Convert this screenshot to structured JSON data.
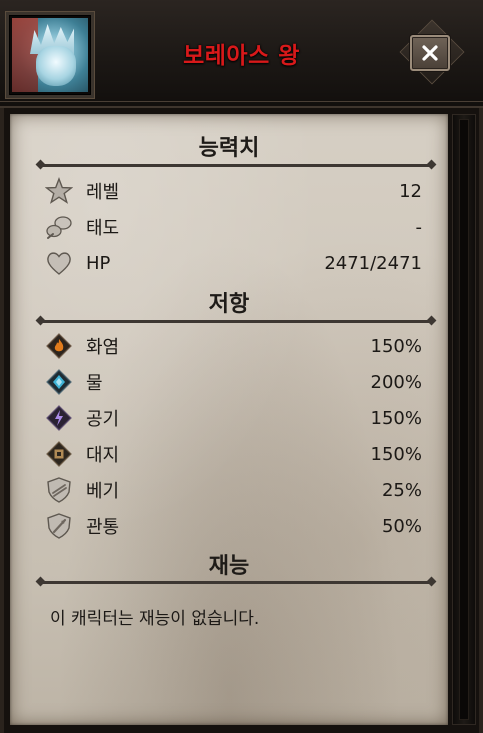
{
  "header": {
    "title": "보레아스 왕",
    "portrait_icon": "frost-king-portrait",
    "close_icon": "close-x-icon"
  },
  "sections": {
    "stats": {
      "title": "능력치",
      "rows": [
        {
          "icon": "star-icon",
          "label": "레벨",
          "value": "12"
        },
        {
          "icon": "fist-icon",
          "label": "태도",
          "value": "-"
        },
        {
          "icon": "heart-icon",
          "label": "HP",
          "value": "2471/2471"
        }
      ]
    },
    "resistance": {
      "title": "저항",
      "rows": [
        {
          "icon": "fire-element-icon",
          "label": "화염",
          "value": "150%"
        },
        {
          "icon": "water-element-icon",
          "label": "물",
          "value": "200%"
        },
        {
          "icon": "air-element-icon",
          "label": "공기",
          "value": "150%"
        },
        {
          "icon": "earth-element-icon",
          "label": "대지",
          "value": "150%"
        },
        {
          "icon": "slash-shield-icon",
          "label": "베기",
          "value": "25%"
        },
        {
          "icon": "pierce-shield-icon",
          "label": "관통",
          "value": "50%"
        }
      ]
    },
    "talents": {
      "title": "재능",
      "text": "이 캐릭터는 재능이 없습니다."
    }
  },
  "colors": {
    "title_red": "#d8191a",
    "parchment": "#cfc7bb",
    "fire": "#e07b1c",
    "water": "#3fb3d6",
    "air": "#8d5fd4",
    "earth": "#b08a55"
  }
}
